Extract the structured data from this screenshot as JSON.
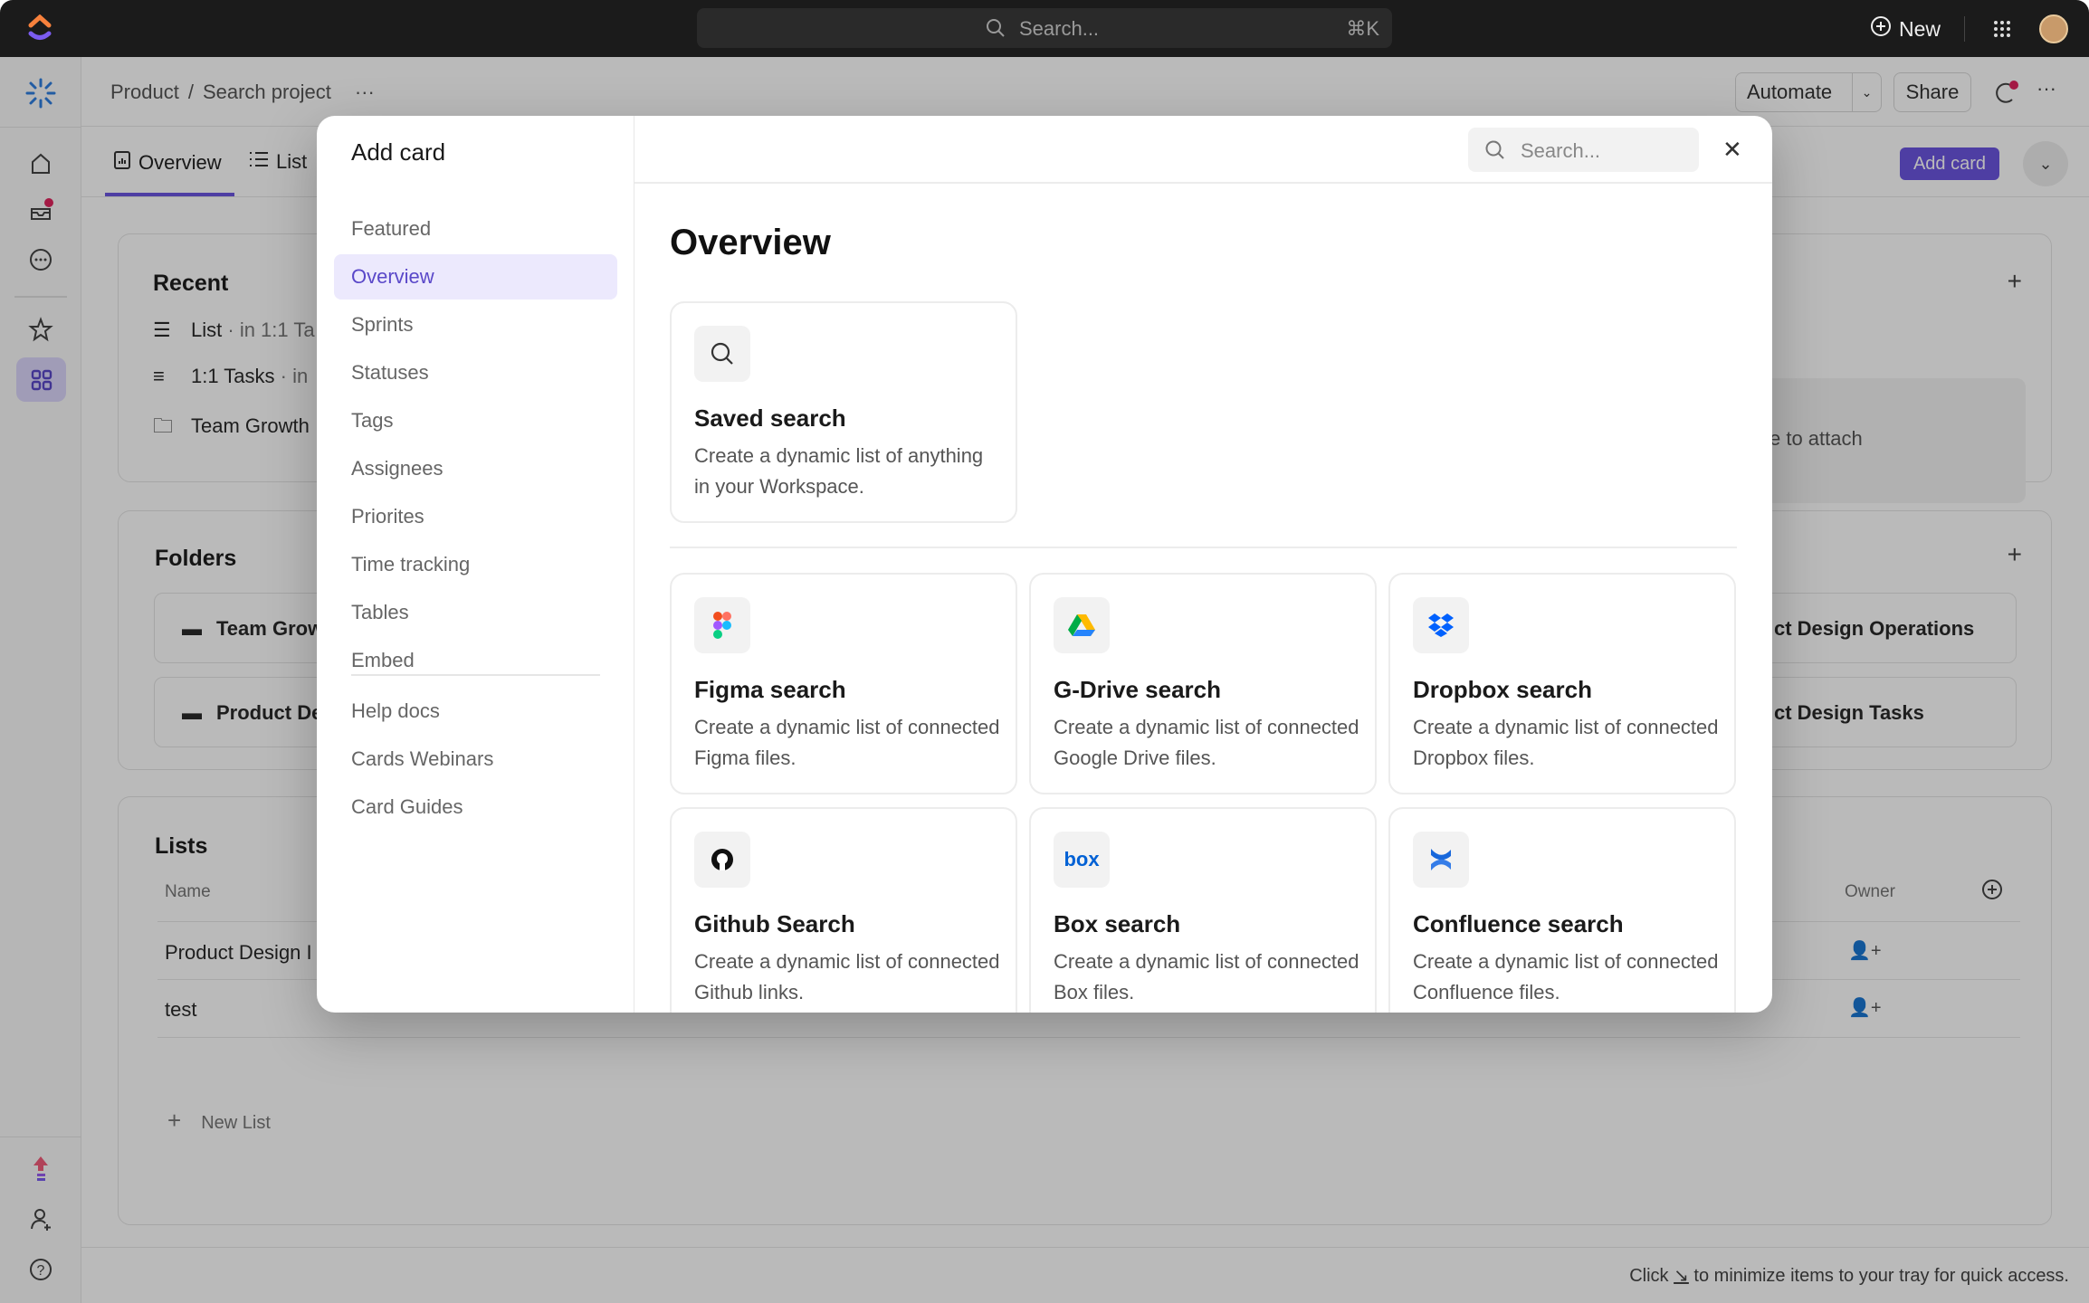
{
  "topbar": {
    "search_placeholder": "Search...",
    "shortcut": "⌘K",
    "new_label": "New"
  },
  "header": {
    "breadcrumb": [
      "Product",
      "Search project"
    ],
    "separator": "/",
    "more": "···",
    "automate": "Automate",
    "share": "Share"
  },
  "tabs": [
    {
      "label": "Overview",
      "active": true
    },
    {
      "label": "List"
    }
  ],
  "add_card_button": "Add card",
  "recent": {
    "title": "Recent",
    "items": [
      {
        "name": "List",
        "meta": "· in 1:1 Ta"
      },
      {
        "name": "1:1 Tasks",
        "meta": "· in"
      },
      {
        "name": "Team Growth",
        "meta": ""
      }
    ],
    "attach_text": "e to attach"
  },
  "folders": {
    "title": "Folders",
    "items": [
      "Team Grow",
      "Product De",
      "ct Design Operations",
      "ct Design Tasks"
    ]
  },
  "lists": {
    "title": "Lists",
    "columns": [
      "Name",
      "Owner"
    ],
    "rows": [
      "Product Design I",
      "test"
    ],
    "new_list": "New List"
  },
  "footer_hint": {
    "before": "Click",
    "icon": "minimize-arrow",
    "after": "to minimize items to your tray for quick access."
  },
  "modal": {
    "title": "Add card",
    "search_placeholder": "Search...",
    "nav": [
      {
        "label": "Featured"
      },
      {
        "label": "Overview",
        "active": true
      },
      {
        "label": "Sprints"
      },
      {
        "label": "Statuses"
      },
      {
        "label": "Tags"
      },
      {
        "label": "Assignees"
      },
      {
        "label": "Priorites"
      },
      {
        "label": "Time tracking"
      },
      {
        "label": "Tables"
      },
      {
        "label": "Embed"
      }
    ],
    "nav_links": [
      "Help docs",
      "Cards Webinars",
      "Card Guides"
    ],
    "section_title": "Overview",
    "featured_card": {
      "title": "Saved search",
      "desc": "Create a dynamic list of anything in your Workspace.",
      "icon": "search-icon"
    },
    "cards": [
      {
        "title": "Figma search",
        "desc": "Create a dynamic list of connected Figma files.",
        "icon": "figma-icon"
      },
      {
        "title": "G-Drive search",
        "desc": "Create a dynamic list of connected Google Drive files.",
        "icon": "google-drive-icon"
      },
      {
        "title": "Dropbox search",
        "desc": "Create a dynamic list of connected Dropbox files.",
        "icon": "dropbox-icon"
      },
      {
        "title": "Github Search",
        "desc": "Create a dynamic list of connected Github links.",
        "icon": "github-icon"
      },
      {
        "title": "Box search",
        "desc": "Create a dynamic list of connected Box files.",
        "icon": "box-icon",
        "icon_text": "box"
      },
      {
        "title": "Confluence search",
        "desc": "Create a dynamic list of connected Confluence files.",
        "icon": "confluence-icon"
      }
    ]
  },
  "colors": {
    "accent": "#6c55e0",
    "active_nav_bg": "#ece9fd",
    "topbar": "#1b1b1b",
    "notification": "#e0245e"
  }
}
